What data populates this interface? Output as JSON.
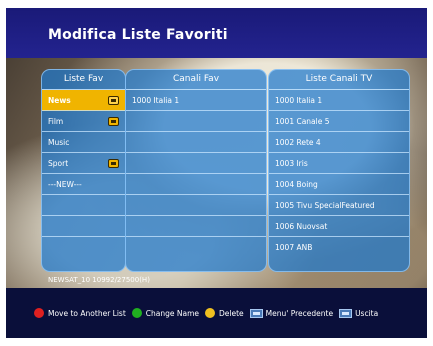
{
  "title": "Modifica Liste Favoriti",
  "columns": {
    "fav": {
      "header": "Liste Fav",
      "items": [
        {
          "label": "News",
          "tv": true,
          "selected": true
        },
        {
          "label": "Film",
          "tv": true
        },
        {
          "label": "Music",
          "tv": false
        },
        {
          "label": "Sport",
          "tv": true
        },
        {
          "label": "---NEW---",
          "tv": false
        },
        {
          "label": "",
          "tv": false
        },
        {
          "label": "",
          "tv": false
        },
        {
          "label": "",
          "tv": false
        }
      ]
    },
    "canali_fav": {
      "header": "Canali Fav",
      "items": [
        "1000 Italia 1",
        "",
        "",
        "",
        "",
        "",
        "",
        ""
      ]
    },
    "canali_tv": {
      "header": "Liste Canali TV",
      "items": [
        "1000 Italia 1",
        "1001 Canale 5",
        "1002 Rete 4",
        "1003 Iris",
        "1004 Boing",
        "1005 Tivu SpecialFeatured",
        "1006 Nuovsat",
        "1007 ANB"
      ]
    }
  },
  "sat_info": "NEWSAT_10 10992/27500(H)",
  "legend": {
    "move": "Move to Another List",
    "change": "Change Name",
    "delete": "Delete",
    "menu": "Menu' Precedente",
    "exit": "Uscita"
  },
  "colors": {
    "accent": "#f0b400",
    "panel": "#1e78cd",
    "red": "#e02020",
    "green": "#20b020",
    "yellow": "#f0c020"
  }
}
